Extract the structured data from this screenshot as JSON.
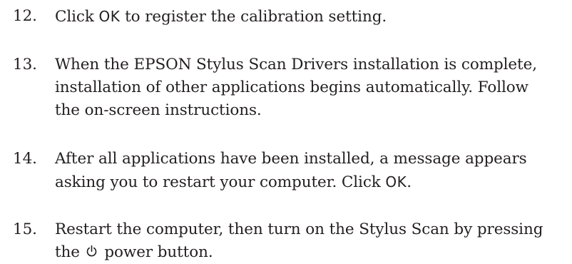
{
  "steps": [
    {
      "number": "12.",
      "lines": [
        {
          "before": "Click ",
          "ui": "OK",
          "after": " to register the calibration setting."
        }
      ]
    },
    {
      "number": "13.",
      "lines": [
        {
          "text": "When the EPSON Stylus Scan Drivers installation is complete,"
        },
        {
          "text": "installation of other applications begins automatically. Follow"
        },
        {
          "text": "the on-screen instructions."
        }
      ]
    },
    {
      "number": "14.",
      "lines": [
        {
          "text": "After all applications have been installed, a message appears"
        },
        {
          "before": "asking you to restart your computer. Click ",
          "ui": "OK",
          "after": "."
        }
      ]
    },
    {
      "number": "15.",
      "lines": [
        {
          "text": "Restart the computer, then turn on the Stylus Scan by pressing"
        },
        {
          "before": "the ",
          "icon": "power-icon",
          "after": " power button."
        }
      ]
    }
  ]
}
